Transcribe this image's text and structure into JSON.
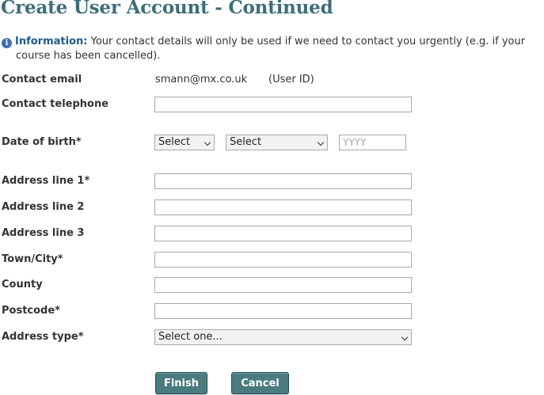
{
  "page": {
    "title": "Create User Account - Continued"
  },
  "info": {
    "label": "Information:",
    "text_line1": " Your contact details will only be used if we need to contact you urgently (e.g. if your",
    "text_line2": "course has been cancelled)."
  },
  "form": {
    "contact_email": {
      "label": "Contact email",
      "value": "smann@mx.co.uk",
      "note": "(User ID)"
    },
    "contact_telephone": {
      "label": "Contact telephone",
      "value": ""
    },
    "date_of_birth": {
      "label": "Date of birth*",
      "day_selected": "Select",
      "month_selected": "Select",
      "year_value": "",
      "year_placeholder": "YYYY"
    },
    "address_line_1": {
      "label": "Address line 1*",
      "value": ""
    },
    "address_line_2": {
      "label": "Address line 2",
      "value": ""
    },
    "address_line_3": {
      "label": "Address line 3",
      "value": ""
    },
    "town_city": {
      "label": "Town/City*",
      "value": ""
    },
    "county": {
      "label": "County",
      "value": ""
    },
    "postcode": {
      "label": "Postcode*",
      "value": ""
    },
    "address_type": {
      "label": "Address type*",
      "selected": "Select one..."
    }
  },
  "actions": {
    "finish_label": "Finish",
    "cancel_label": "Cancel"
  },
  "colors": {
    "title": "#3d6e78",
    "info_label": "#1f5a8a",
    "info_icon": "#3f6db3",
    "button_bg": "#4a7b7f"
  },
  "icons": {
    "info": "information-icon",
    "dropdown": "chevron-down-icon"
  }
}
